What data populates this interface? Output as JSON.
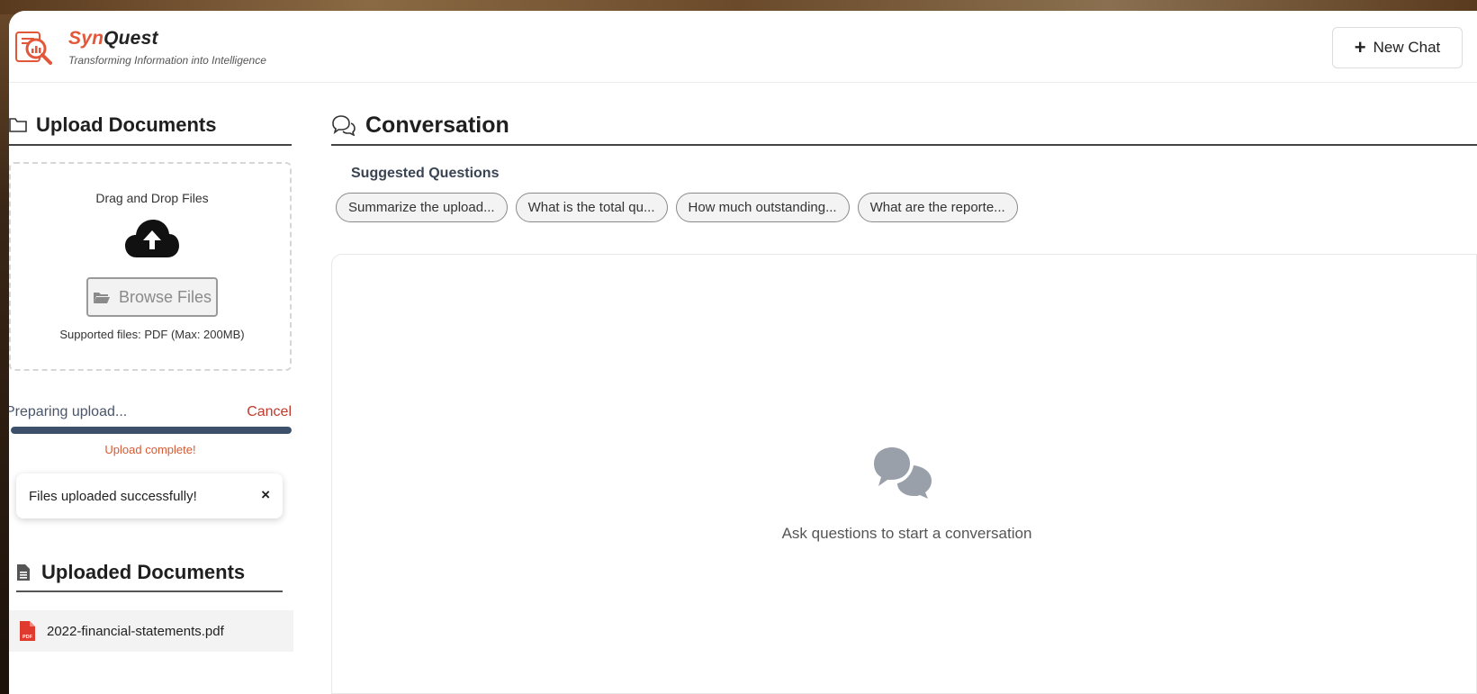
{
  "app": {
    "brand_prefix": "Syn",
    "brand_suffix": "Quest",
    "tagline": "Transforming Information into Intelligence",
    "accent_color": "#e2573a"
  },
  "header": {
    "new_chat_label": "New Chat",
    "new_chat_icon": "plus-icon"
  },
  "sidebar": {
    "upload_title": "Upload Documents",
    "upload_icon": "folder-icon",
    "dropzone": {
      "drag_text": "Drag and Drop Files",
      "upload_icon": "cloud-upload-icon",
      "browse_label": "Browse Files",
      "browse_icon": "folder-open-icon",
      "supported_text": "Supported files: PDF (Max: 200MB)"
    },
    "progress": {
      "label": "Preparing upload...",
      "cancel_label": "Cancel",
      "percent": 100,
      "complete_text": "Upload complete!",
      "bar_color": "#3c4f6b"
    },
    "toast": {
      "message": "Files uploaded successfully!",
      "close_label": "×"
    },
    "uploaded_title": "Uploaded Documents",
    "uploaded_icon": "file-icon",
    "documents": [
      {
        "name": "2022-financial-statements.pdf",
        "icon": "pdf-file-icon"
      }
    ]
  },
  "main": {
    "conversation_title": "Conversation",
    "conversation_icon": "chat-bubbles-outline-icon",
    "suggested_title": "Suggested Questions",
    "suggestions": [
      "Summarize the upload...",
      "What is the total qu...",
      "How much outstanding...",
      "What are the reporte..."
    ],
    "empty_icon": "chat-bubbles-icon",
    "empty_text": "Ask questions to start a conversation"
  }
}
